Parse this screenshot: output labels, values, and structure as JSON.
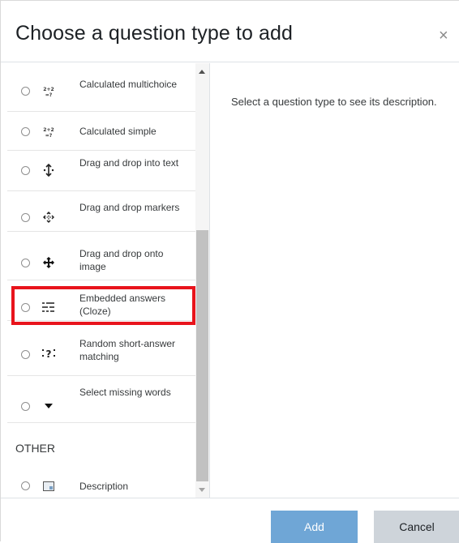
{
  "dialog": {
    "title": "Choose a question type to add",
    "close_symbol": "×"
  },
  "options": [
    {
      "label": "Calculated multichoice",
      "icon": "calculated-multichoice-icon"
    },
    {
      "label": "Calculated simple",
      "icon": "calculated-simple-icon"
    },
    {
      "label": "Drag and drop into text",
      "icon": "drag-drop-text-icon"
    },
    {
      "label": "Drag and drop markers",
      "icon": "drag-drop-markers-icon"
    },
    {
      "label": "Drag and drop onto image",
      "icon": "drag-drop-image-icon"
    },
    {
      "label": "Embedded answers (Cloze)",
      "icon": "cloze-icon",
      "highlighted": true
    },
    {
      "label": "Random short-answer matching",
      "icon": "random-match-icon"
    },
    {
      "label": "Select missing words",
      "icon": "select-missing-words-icon"
    }
  ],
  "other": {
    "heading": "OTHER",
    "items": [
      {
        "label": "Description",
        "icon": "description-icon"
      }
    ]
  },
  "description": {
    "text": "Select a question type to see its description."
  },
  "footer": {
    "add_label": "Add",
    "cancel_label": "Cancel"
  },
  "colors": {
    "highlight": "#e8141c",
    "add_button": "#6fa6d6",
    "cancel_button": "#ced4da"
  }
}
